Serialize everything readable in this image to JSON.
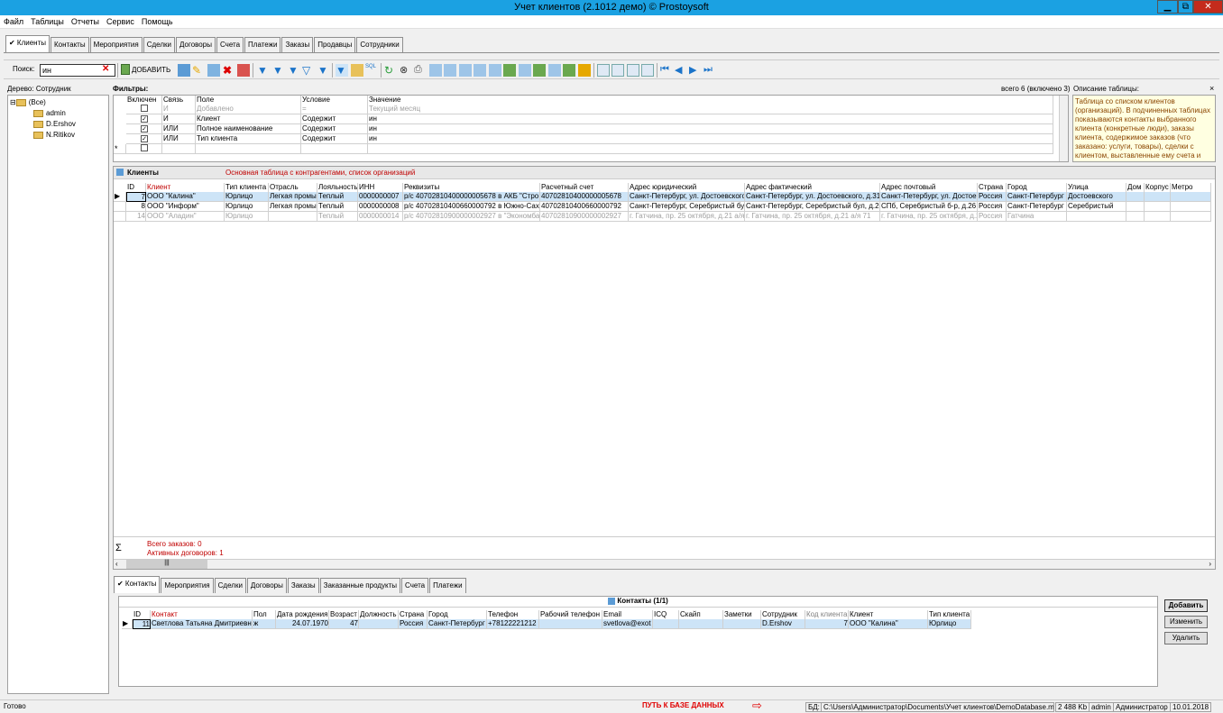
{
  "window": {
    "title": "Учет клиентов (2.1012 демо) © Prostoysoft",
    "min": "▁",
    "max": "⧉",
    "close": "✕"
  },
  "menu": [
    "Файл",
    "Таблицы",
    "Отчеты",
    "Сервис",
    "Помощь"
  ],
  "tabs": [
    "✔ Клиенты",
    "Контакты",
    "Мероприятия",
    "Сделки",
    "Договоры",
    "Счета",
    "Платежи",
    "Заказы",
    "Продавцы",
    "Сотрудники"
  ],
  "toolbar": {
    "search_label": "Поиск:",
    "search_value": "ин",
    "add_label": "ДОБАВИТЬ"
  },
  "tree": {
    "title": "Дерево: Сотрудник",
    "items": [
      "(Все)",
      "admin",
      "D.Ershov",
      "N.Ritikov"
    ]
  },
  "filters": {
    "title": "Фильтры:",
    "summary": "всего 6 (включено 3)",
    "headers": [
      "Включен",
      "Связь",
      "Поле",
      "Условие",
      "Значение"
    ],
    "rows": [
      [
        "",
        "И",
        "Добавлено",
        "=",
        "Текущий месяц"
      ],
      [
        "✓",
        "И",
        "Клиент",
        "Содержит",
        "ин"
      ],
      [
        "✓",
        "ИЛИ",
        "Полное наименование",
        "Содержит",
        "ин"
      ],
      [
        "✓",
        "ИЛИ",
        "Тип клиента",
        "Содержит",
        "ин"
      ]
    ],
    "new_row_marker": "*"
  },
  "description": {
    "title": "Описание таблицы:",
    "text": "Таблица со списком клиентов (организаций). В подчиненных таблицах показываются контакты выбранного клиента (конкретные люди), заказы клиента, содержимое заказов (что заказано: услуги, товары), сделки с клиентом, выставленные ему счета и",
    "close": "×"
  },
  "clients": {
    "title": "Клиенты",
    "subtitle": "Основная таблица с контрагентами, список организаций",
    "headers": [
      "ID",
      "Клиент",
      "Тип клиента",
      "Отрасль",
      "Лояльность",
      "ИНН",
      "Реквизиты",
      "Расчетный счет",
      "Адрес юридический",
      "Адрес фактический",
      "Адрес почтовый",
      "Страна",
      "Город",
      "Улица",
      "Дом",
      "Корпус",
      "Метро"
    ],
    "rows": [
      [
        "7",
        "ООО \"Калина\"",
        "Юрлицо",
        "Легкая промы",
        "Теплый",
        "0000000007",
        "р/с 40702810400000005678  в АКБ \"Стро",
        "40702810400000005678",
        "Санкт-Петербург, ул. Достоевского",
        "Санкт-Петербург, ул. Достоевского, д.31",
        "Санкт-Петербург, ул. Достоев",
        "Россия",
        "Санкт-Петербург",
        "Достоевского",
        "",
        "",
        ""
      ],
      [
        "8",
        "ООО \"Информ\"",
        "Юрлицо",
        "Легкая промы",
        "Теплый",
        "0000000008",
        "р/с 40702810400660000792 в Южно-Саха",
        "40702810400660000792",
        "Санкт-Петербург, Серебристый бул",
        "Санкт-Петербург, Серебристый бул, д.26",
        "СПб, Серебристый б-р, д.26",
        "Россия",
        "Санкт-Петербург",
        "Серебристый",
        "",
        "",
        ""
      ],
      [
        "14",
        "ООО \"Аладин\"",
        "Юрлицо",
        "",
        "Теплый",
        "0000000014",
        "р/с 40702810900000002927 в \"Экономба",
        "40702810900000002927",
        "г. Гатчина, пр. 25 октября, д.21 а/я",
        "г. Гатчина, пр. 25 октября, д.21 а/я 71",
        "г. Гатчина, пр. 25 октября, д.2",
        "Россия",
        "Гатчина",
        "",
        "",
        "",
        ""
      ]
    ],
    "summary": [
      "Всего заказов: 0",
      "Активных договоров: 1"
    ],
    "sigma": "Σ",
    "scroll_grip": "|||"
  },
  "subtabs": [
    "✔ Контакты",
    "Мероприятия",
    "Сделки",
    "Договоры",
    "Заказы",
    "Заказанные продукты",
    "Счета",
    "Платежи"
  ],
  "contacts": {
    "title": "Контакты (1/1)",
    "headers": [
      "ID",
      "Контакт",
      "Пол",
      "Дата рождения",
      "Возраст",
      "Должность",
      "Страна",
      "Город",
      "Телефон",
      "Рабочий телефон",
      "Email",
      "ICQ",
      "Скайп",
      "Заметки",
      "Сотрудник",
      "Код клиента",
      "Клиент",
      "Тип клиента"
    ],
    "rows": [
      [
        "11",
        "Светлова Татьяна Дмитриевн",
        "ж",
        "24.07.1970",
        "47",
        "",
        "Россия",
        "Санкт-Петербург",
        "+78122221212",
        "",
        "svetlova@exot",
        "",
        "",
        "",
        "D.Ershov",
        "7",
        "ООО \"Калина\"",
        "Юрлицо"
      ]
    ],
    "buttons": [
      "Добавить",
      "Изменить",
      "Удалить"
    ]
  },
  "status": {
    "ready": "Готово",
    "db_path_label": "ПУТЬ К БАЗЕ ДАННЫХ",
    "db": "БД:",
    "path": "C:\\Users\\Администратор\\Documents\\Учет клиентов\\DemoDatabase.mdb",
    "size": "2 488 Kb",
    "user": "admin",
    "role": "Администратор",
    "date": "10.01.2018"
  },
  "colors": {
    "titlebar": "#1ba1e2",
    "selected_row": "#cde4f7",
    "accent_red": "#c00000",
    "desc_bg": "#ffffe1"
  }
}
